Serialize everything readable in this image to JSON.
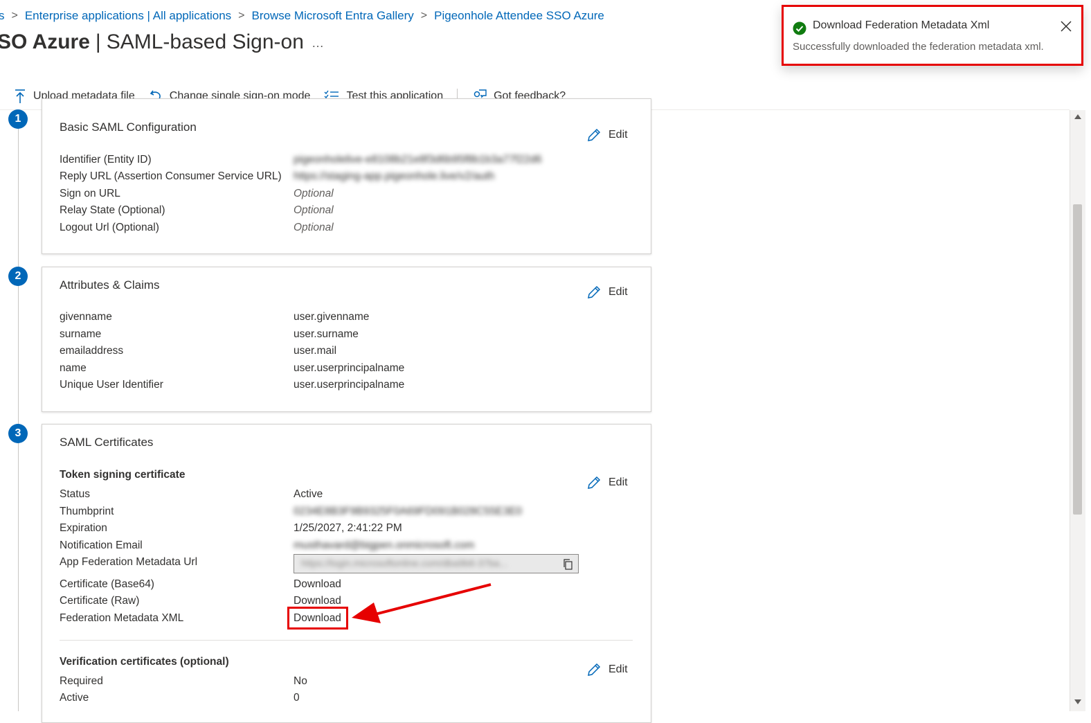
{
  "breadcrumb": {
    "items": [
      "s",
      "Enterprise applications | All applications",
      "Browse Microsoft Entra Gallery",
      "Pigeonhole Attendee SSO Azure"
    ]
  },
  "header": {
    "title_bold": "SO Azure",
    "title_rest": "SAML-based Sign-on",
    "more": "…"
  },
  "toolbar": {
    "upload": "Upload metadata file",
    "change_mode": "Change single sign-on mode",
    "test": "Test this application",
    "feedback": "Got feedback?"
  },
  "steps": [
    "1",
    "2",
    "3"
  ],
  "edit_label": "Edit",
  "basic_saml": {
    "title": "Basic SAML Configuration",
    "rows": [
      {
        "label": "Identifier (Entity ID)",
        "value": "pigeonholelive-e8108b21e8f3d6b95f8b1b3a77f22d6"
      },
      {
        "label": "Reply URL (Assertion Consumer Service URL)",
        "value": "https://staging-app.pigeonhole.live/v2/auth"
      },
      {
        "label": "Sign on URL",
        "value": "Optional"
      },
      {
        "label": "Relay State (Optional)",
        "value": "Optional"
      },
      {
        "label": "Logout Url (Optional)",
        "value": "Optional"
      }
    ]
  },
  "attributes": {
    "title": "Attributes & Claims",
    "rows": [
      {
        "label": "givenname",
        "value": "user.givenname"
      },
      {
        "label": "surname",
        "value": "user.surname"
      },
      {
        "label": "emailaddress",
        "value": "user.mail"
      },
      {
        "label": "name",
        "value": "user.userprincipalname"
      },
      {
        "label": "Unique User Identifier",
        "value": "user.userprincipalname"
      }
    ]
  },
  "certificates": {
    "title": "SAML Certificates",
    "token_heading": "Token signing certificate",
    "status": {
      "label": "Status",
      "value": "Active"
    },
    "thumbprint": {
      "label": "Thumbprint",
      "value": "0234E8B3F9B9325F0A69FD091B028C55E3E0"
    },
    "expiration": {
      "label": "Expiration",
      "value": "1/25/2027, 2:41:22 PM"
    },
    "notification": {
      "label": "Notification Email",
      "value": "musthavard@bigpen.onmicrosoft.com"
    },
    "metadata_url": {
      "label": "App Federation Metadata Url",
      "value": "https://login.microsoftonline.com/dba9b6-37ba..."
    },
    "cert_base64": {
      "label": "Certificate (Base64)",
      "link": "Download"
    },
    "cert_raw": {
      "label": "Certificate (Raw)",
      "link": "Download"
    },
    "fed_xml": {
      "label": "Federation Metadata XML",
      "link": "Download"
    },
    "verification_heading": "Verification certificates (optional)",
    "required": {
      "label": "Required",
      "value": "No"
    },
    "active": {
      "label": "Active",
      "value": "0"
    }
  },
  "toast": {
    "title": "Download Federation Metadata Xml",
    "message": "Successfully downloaded the federation metadata xml."
  },
  "colors": {
    "accent": "#0067b8",
    "highlight": "#e60000",
    "success": "#107c10"
  }
}
